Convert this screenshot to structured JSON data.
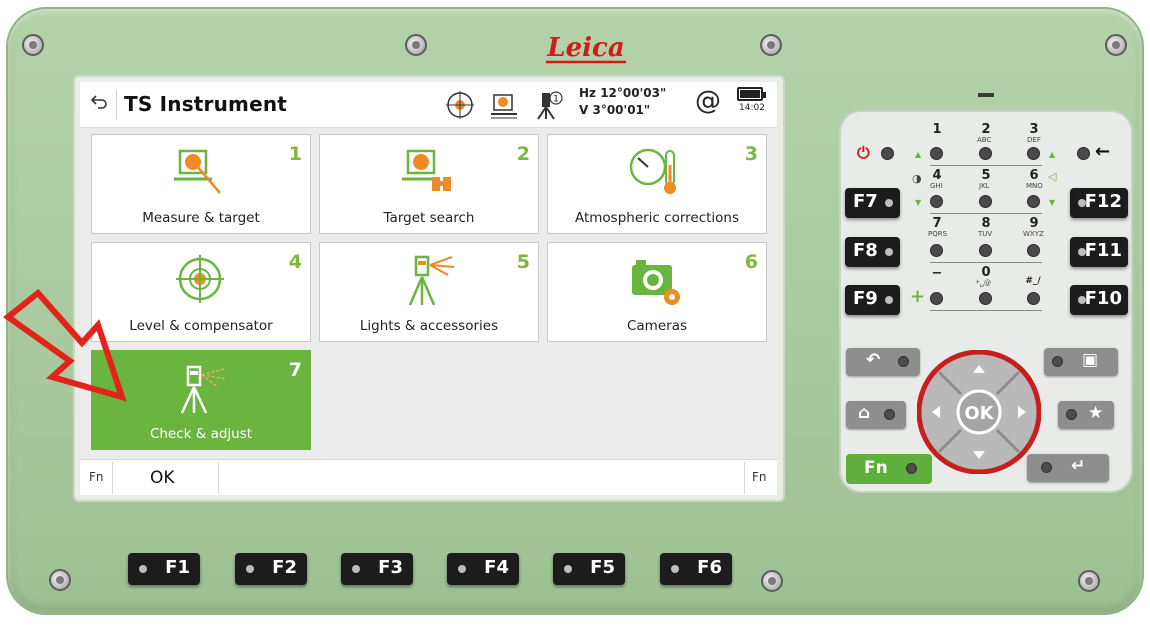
{
  "device": {
    "brand": "Leica",
    "colors": {
      "housing": "#a8c99e",
      "accent_green": "#6ab540",
      "tile_number": "#7cb93d",
      "arrow_red": "#e2231a",
      "dpad_ring": "#c81e1e"
    }
  },
  "screen": {
    "title": "TS Instrument",
    "back_icon": "back-arrow-icon",
    "status": {
      "hz_label": "Hz 12°00'03\"",
      "v_label": "V  3°00'01\"",
      "at_symbol": "@",
      "time": "14:02",
      "icons": [
        "target-crosshair-icon",
        "measure-target-icon",
        "instrument-face-icon"
      ],
      "face_number": "1"
    },
    "tiles": [
      {
        "num": "1",
        "label": "Measure & target",
        "icon": "measure-target-icon",
        "active": false
      },
      {
        "num": "2",
        "label": "Target search",
        "icon": "target-search-icon",
        "active": false
      },
      {
        "num": "3",
        "label": "Atmospheric corrections",
        "icon": "atmospheric-icon",
        "active": false
      },
      {
        "num": "4",
        "label": "Level & compensator",
        "icon": "level-icon",
        "active": false
      },
      {
        "num": "5",
        "label": "Lights & accessories",
        "icon": "lights-icon",
        "active": false
      },
      {
        "num": "6",
        "label": "Cameras",
        "icon": "camera-icon",
        "active": false
      },
      {
        "num": "7",
        "label": "Check & adjust",
        "icon": "check-adjust-icon",
        "active": true
      }
    ],
    "bottom_bar": {
      "fn_left": "Fn",
      "ok": "OK",
      "fn_right": "Fn"
    }
  },
  "fkeys": [
    "F1",
    "F2",
    "F3",
    "F4",
    "F5",
    "F6"
  ],
  "side_fkeys": {
    "left": [
      "F7",
      "F8",
      "F9"
    ],
    "right": [
      "F12",
      "F11",
      "F10"
    ]
  },
  "keypad": {
    "digits": [
      {
        "d": "1",
        "sub": ""
      },
      {
        "d": "2",
        "sub": "ABC"
      },
      {
        "d": "3",
        "sub": "DEF"
      },
      {
        "d": "4",
        "sub": "GHI"
      },
      {
        "d": "5",
        "sub": "JKL"
      },
      {
        "d": "6",
        "sub": "MNO"
      },
      {
        "d": "7",
        "sub": "PQRS"
      },
      {
        "d": "8",
        "sub": "TUV"
      },
      {
        "d": "9",
        "sub": "WXYZ"
      },
      {
        "d": "−",
        "sub": ""
      },
      {
        "d": "0",
        "sub": "*␣@"
      },
      {
        "d": "#_/",
        "sub": ""
      }
    ],
    "ok_label": "OK",
    "fn_label": "Fn"
  }
}
